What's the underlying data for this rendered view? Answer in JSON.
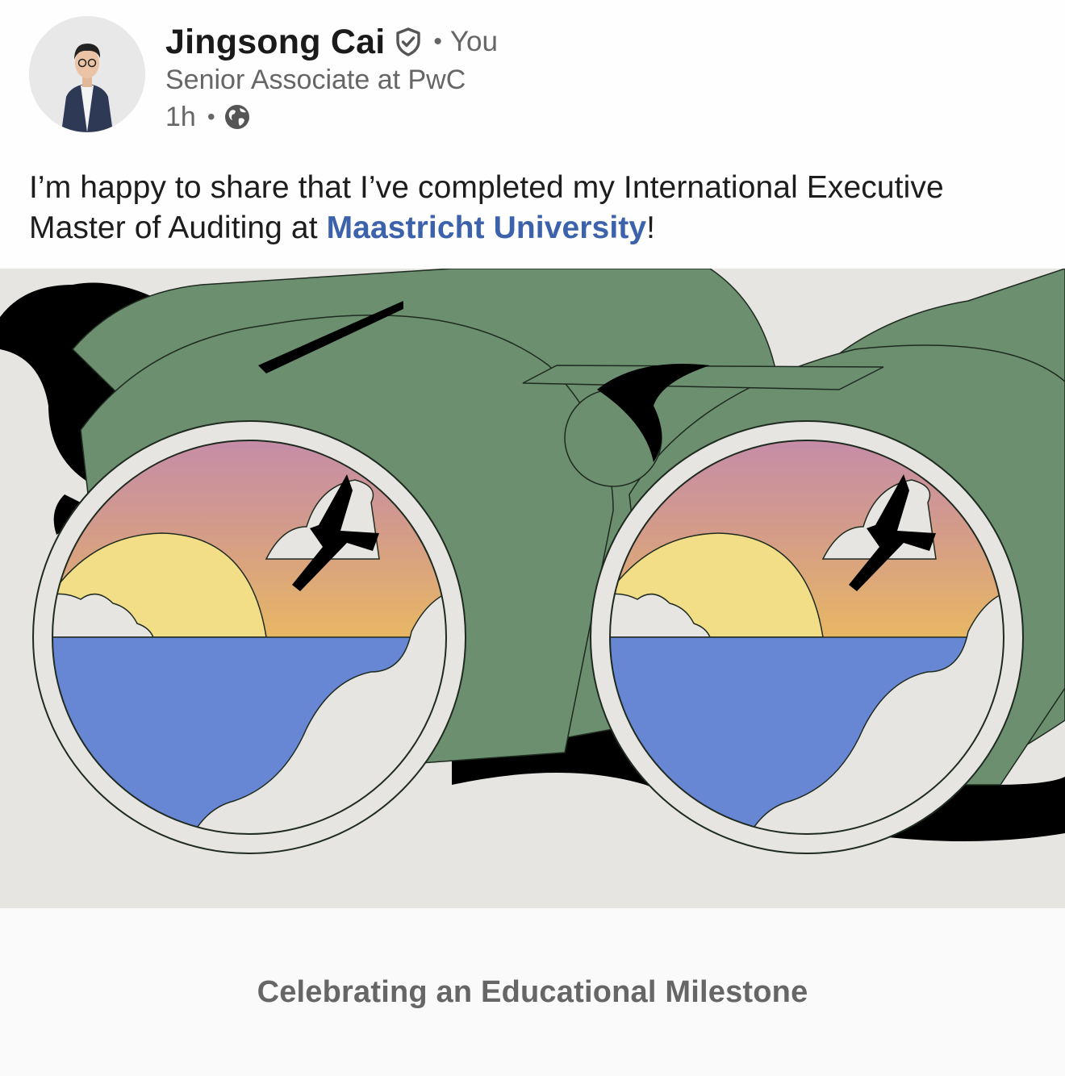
{
  "author": {
    "name": "Jingsong Cai",
    "relation": "You",
    "headline": "Senior Associate at PwC",
    "time": "1h",
    "verified_icon": "shield-check-icon",
    "visibility_icon": "globe-icon",
    "separator": "•"
  },
  "post": {
    "text_before": "I’m happy to share that I’ve completed my International Executive Master of Auditing at ",
    "link_text": "Maastricht University",
    "text_after": "!"
  },
  "media": {
    "caption": "Celebrating an Educational Milestone"
  },
  "colors": {
    "link": "#3d62ac",
    "binocular_green": "#6b8f6f",
    "water_blue": "#6787d5",
    "sun_yellow": "#f2de86",
    "background": "#e7e5e1"
  }
}
